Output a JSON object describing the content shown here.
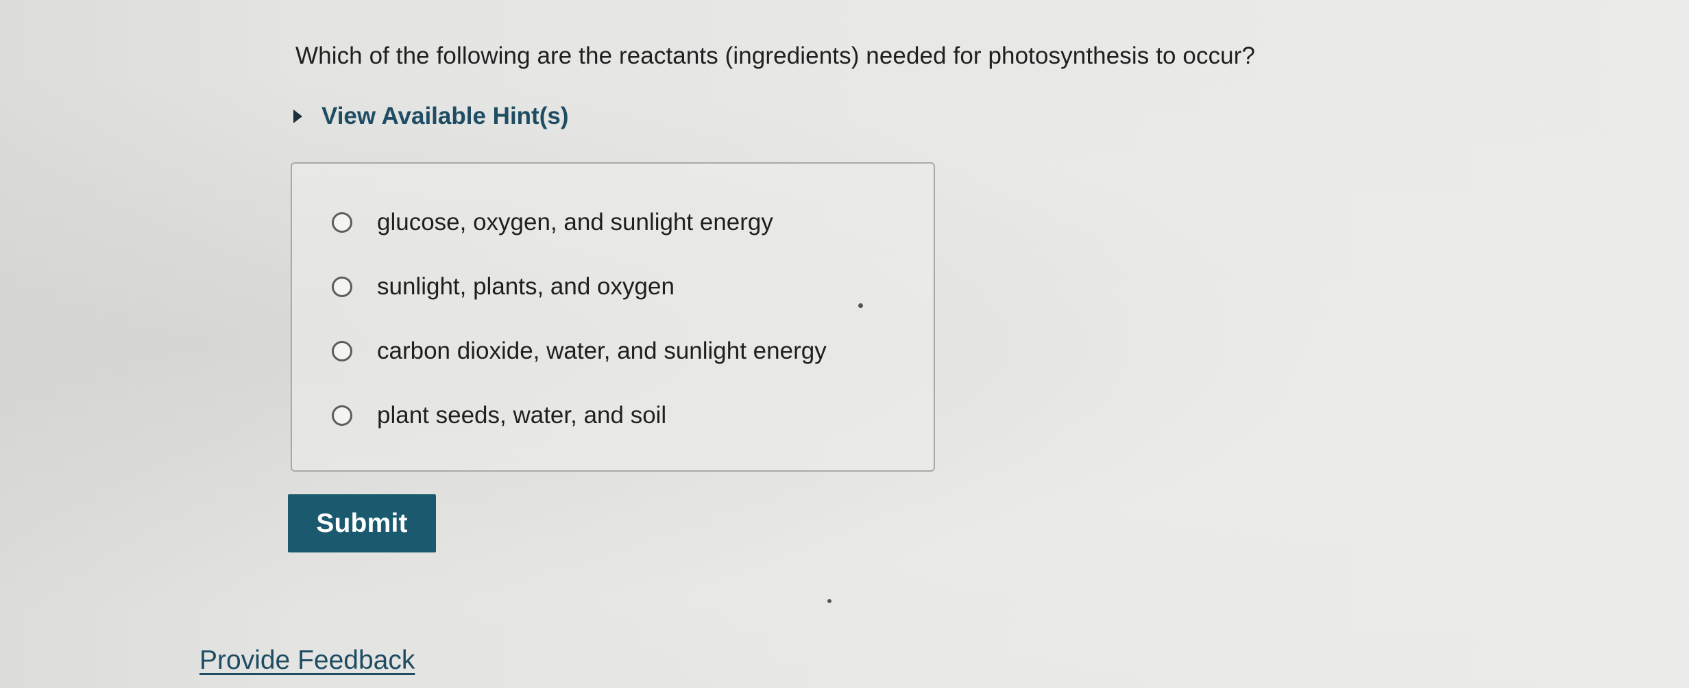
{
  "question": {
    "text": "Which of the following are the reactants (ingredients) needed for photosynthesis to occur?"
  },
  "hint": {
    "icon": "caret-right-icon",
    "label": "View Available Hint(s)"
  },
  "options": [
    {
      "label": "glucose, oxygen, and sunlight energy",
      "selected": false
    },
    {
      "label": "sunlight, plants, and oxygen",
      "selected": false
    },
    {
      "label": "carbon dioxide, water, and sunlight energy",
      "selected": false
    },
    {
      "label": "plant seeds, water, and soil",
      "selected": false
    }
  ],
  "submit": {
    "label": "Submit"
  },
  "feedback": {
    "label": "Provide Feedback"
  },
  "colors": {
    "accent": "#1b5a6e",
    "link": "#1e4d63",
    "background": "#e6e6e4"
  }
}
